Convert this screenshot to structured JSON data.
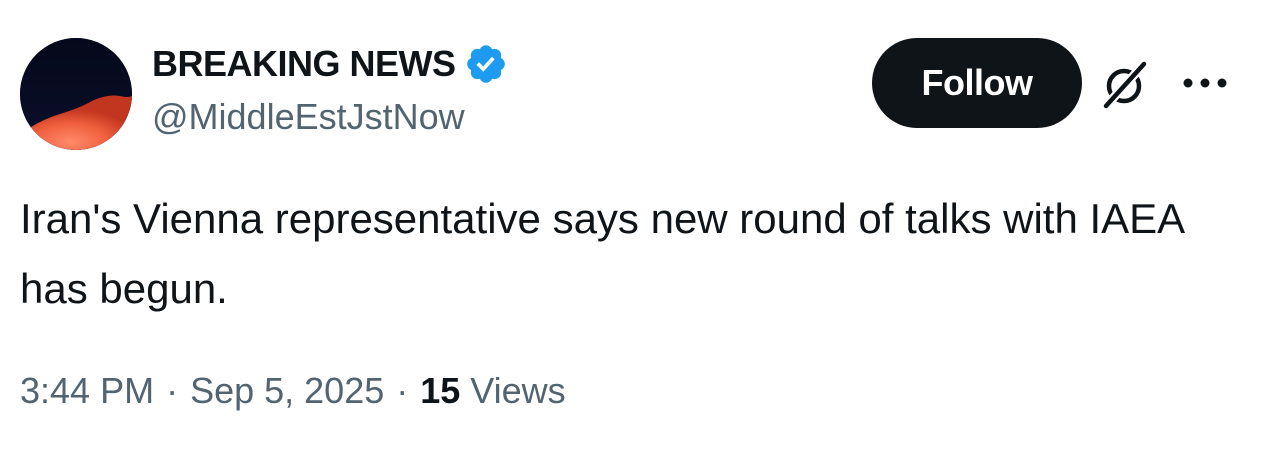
{
  "author": {
    "display_name": "BREAKING NEWS",
    "handle": "@MiddleEstJstNow",
    "verified": true,
    "avatar_icon": "avatar-image"
  },
  "actions": {
    "follow_label": "Follow",
    "grok_icon": "grok-icon",
    "more_icon": "more-options-icon"
  },
  "tweet": {
    "text": "Iran's Vienna representative says new round of talks with IAEA has begun."
  },
  "meta": {
    "time": "3:44 PM",
    "separator": "·",
    "date": "Sep 5, 2025",
    "views_count": "15",
    "views_label": "Views"
  },
  "colors": {
    "text_primary": "#0f1419",
    "text_secondary": "#536471",
    "verified_blue": "#1d9bf0",
    "button_bg": "#0f1419",
    "button_text": "#ffffff"
  }
}
